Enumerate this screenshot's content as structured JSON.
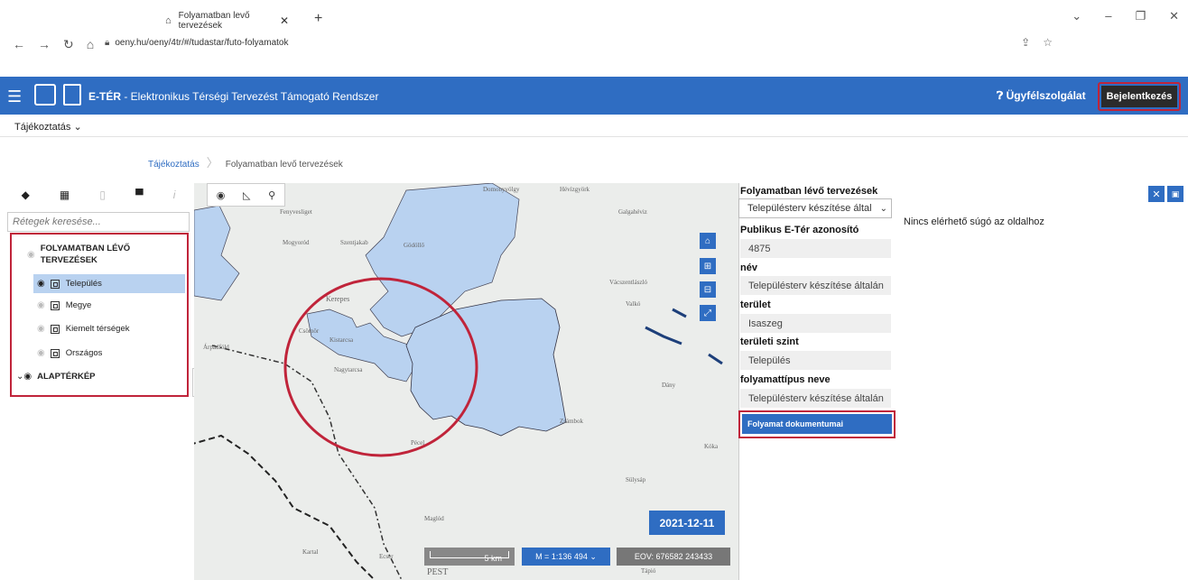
{
  "browser": {
    "tab_title": "Folyamatban levő tervezések",
    "url": "oeny.hu/oeny/4tr/#/tudastar/futo-folyamatok"
  },
  "header": {
    "title_bold": "E-TÉR",
    "title_rest": " - Elektronikus Térségi Tervezést Támogató Rendszer",
    "support": "Ügyfélszolgálat",
    "login": "Bejelentkezés"
  },
  "submenu": {
    "label": "Tájékoztatás"
  },
  "breadcrumb": {
    "link": "Tájékoztatás",
    "current": "Folyamatban levő tervezések"
  },
  "layers": {
    "search_placeholder": "Rétegek keresése...",
    "group1": "FOLYAMATBAN LÉVŐ TERVEZÉSEK",
    "items": [
      {
        "label": "Település",
        "visible": true,
        "selected": true
      },
      {
        "label": "Megye",
        "visible": false,
        "selected": false
      },
      {
        "label": "Kiemelt térségek",
        "visible": false,
        "selected": false
      },
      {
        "label": "Országos",
        "visible": false,
        "selected": false
      }
    ],
    "group2": "ALAPTÉRKÉP"
  },
  "map": {
    "date": "2021-12-11",
    "scale_bar": "5 km",
    "scale": "M = 1:136 494",
    "eov": "EOV:  676582 243433",
    "places": [
      "Domonyvölgy",
      "Hévízgyörk",
      "Fenyvesliget",
      "Galgahéviz",
      "Mogyoród",
      "Szentjakab",
      "Gödöllő",
      "Kerepes",
      "Csömör",
      "Kistarcsa",
      "Nagytarcsa",
      "Árpádföld",
      "Vácszentlászló",
      "Valkó",
      "Dány",
      "Zsámbok",
      "Kóka",
      "Sülysáp",
      "Maglód",
      "Ecser",
      "PEST",
      "Tápió",
      "Kartal",
      "Pécel"
    ]
  },
  "info_panel": {
    "title": "Folyamatban lévő tervezések",
    "select_value": "Településterv készítése által",
    "fields": [
      {
        "label": "Publikus E-Tér azonosító",
        "value": "4875"
      },
      {
        "label": "név",
        "value": "Településterv készítése általán"
      },
      {
        "label": "terület",
        "value": "Isaszeg"
      },
      {
        "label": "területi szint",
        "value": "Település"
      },
      {
        "label": "folyamattípus neve",
        "value": "Településterv készítése általán"
      }
    ],
    "doc_button": "Folyamat dokumentumai"
  },
  "help": {
    "text": "Nincs elérhető súgó az oldalhoz"
  },
  "colors": {
    "brand": "#2f6dc2",
    "highlight": "#c0243a",
    "polygon": "#b9d2f0"
  }
}
